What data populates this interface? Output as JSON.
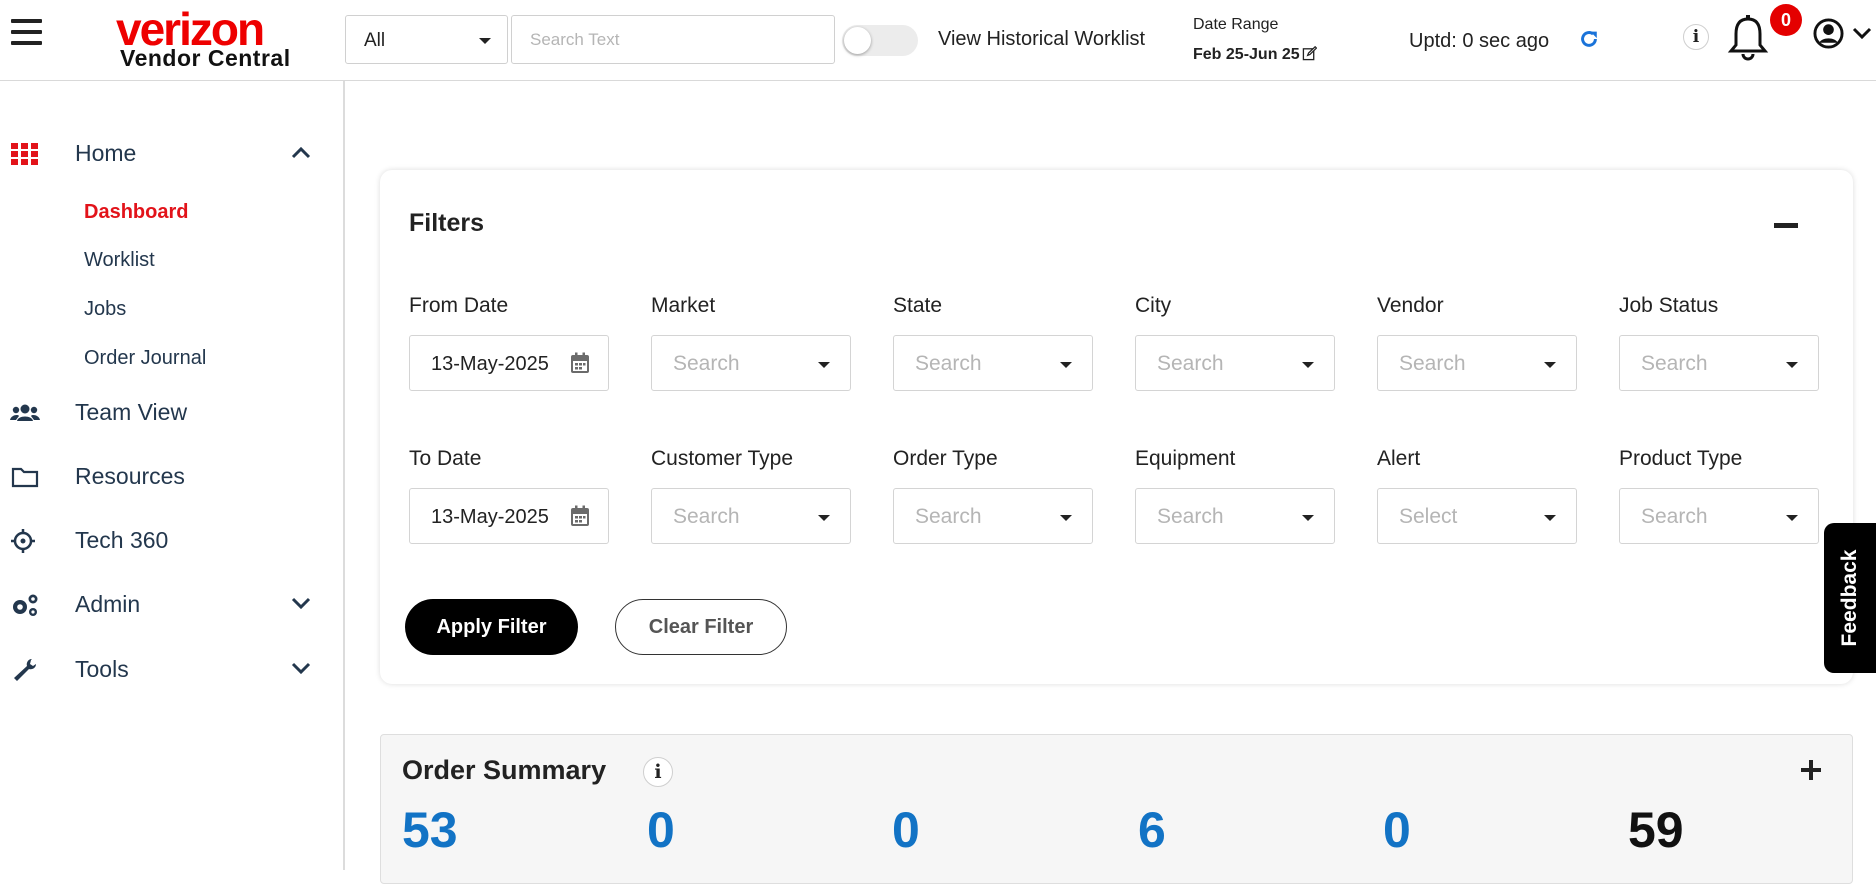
{
  "header": {
    "logo_word": "verizon",
    "logo_sub": "Vendor Central",
    "scope_select": "All",
    "search_placeholder": "Search Text",
    "historical_label": "View Historical Worklist",
    "date_range_label": "Date Range",
    "date_range_value": "Feb 25-Jun 25",
    "updated_text": "Uptd: 0 sec ago",
    "info_glyph": "i",
    "notification_count": "0"
  },
  "sidebar": {
    "home": "Home",
    "home_sub": [
      "Dashboard",
      "Worklist",
      "Jobs",
      "Order Journal"
    ],
    "team_view": "Team View",
    "resources": "Resources",
    "tech360": "Tech 360",
    "admin": "Admin",
    "tools": "Tools"
  },
  "filters": {
    "title": "Filters",
    "from_date_label": "From Date",
    "from_date_value": "13-May-2025",
    "to_date_label": "To Date",
    "to_date_value": "13-May-2025",
    "row1": [
      {
        "label": "Market",
        "placeholder": "Search"
      },
      {
        "label": "State",
        "placeholder": "Search"
      },
      {
        "label": "City",
        "placeholder": "Search"
      },
      {
        "label": "Vendor",
        "placeholder": "Search"
      },
      {
        "label": "Job Status",
        "placeholder": "Search"
      }
    ],
    "row2": [
      {
        "label": "Customer Type",
        "placeholder": "Search"
      },
      {
        "label": "Order Type",
        "placeholder": "Search"
      },
      {
        "label": "Equipment",
        "placeholder": "Search"
      },
      {
        "label": "Alert",
        "placeholder": "Select"
      },
      {
        "label": "Product Type",
        "placeholder": "Search"
      }
    ],
    "apply_label": "Apply Filter",
    "clear_label": "Clear Filter"
  },
  "feedback_label": "Feedback",
  "order_summary": {
    "title": "Order Summary",
    "info_glyph": "i",
    "values": [
      "53",
      "0",
      "0",
      "6",
      "0",
      "59"
    ]
  },
  "colors": {
    "brand_red": "#ee0000",
    "active_nav": "#e2131a",
    "metric_blue": "#1273c5",
    "badge_red": "#e40000"
  }
}
